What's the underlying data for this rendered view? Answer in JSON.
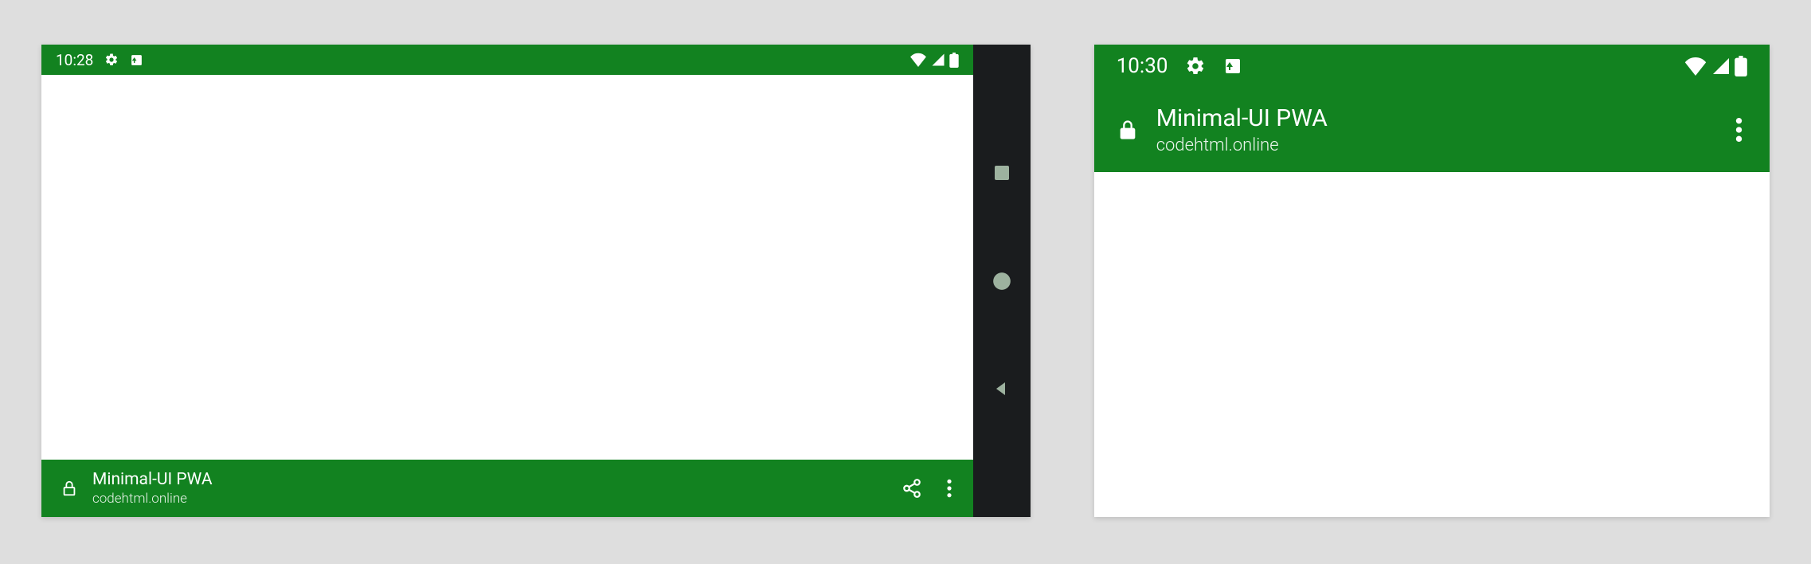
{
  "colors": {
    "theme": "#128220",
    "navbar": "#1a1c1e",
    "nav_icon": "#9db29f"
  },
  "left_device": {
    "status": {
      "time": "10:28"
    },
    "app": {
      "title": "Minimal-UI PWA",
      "url": "codehtml.online"
    }
  },
  "right_device": {
    "status": {
      "time": "10:30"
    },
    "app": {
      "title": "Minimal-UI PWA",
      "url": "codehtml.online"
    }
  }
}
